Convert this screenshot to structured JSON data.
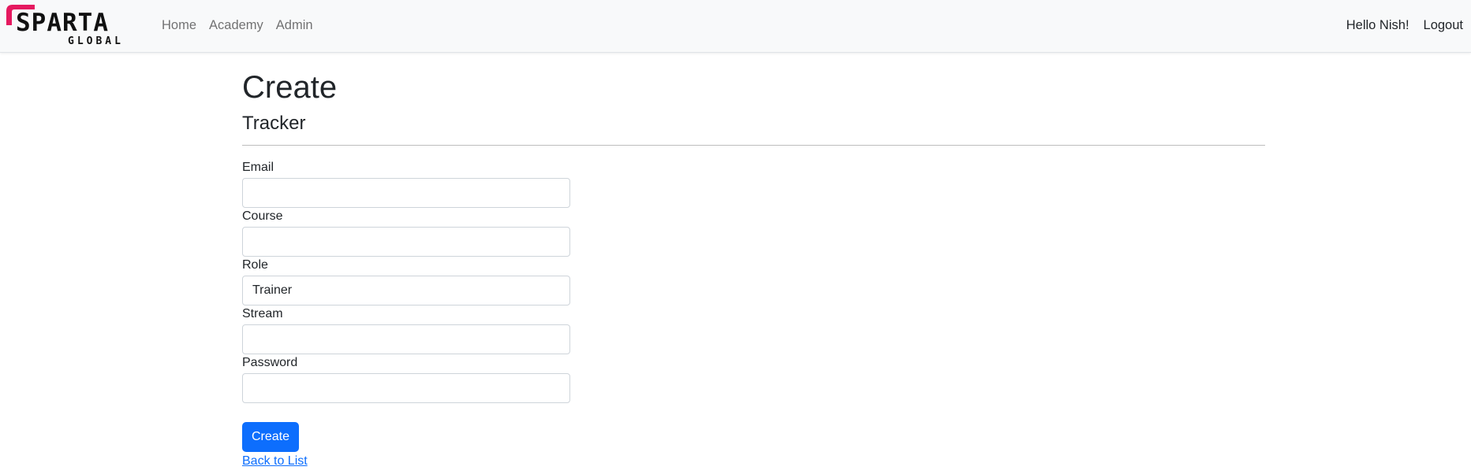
{
  "brand": {
    "name": "SPARTA",
    "sub": "GLOBAL",
    "accent_color": "#e5195f"
  },
  "nav": {
    "links": [
      "Home",
      "Academy",
      "Admin"
    ],
    "greeting": "Hello Nish!",
    "logout": "Logout"
  },
  "page": {
    "title": "Create",
    "subtitle": "Tracker"
  },
  "form": {
    "fields": [
      {
        "label": "Email",
        "value": ""
      },
      {
        "label": "Course",
        "value": ""
      },
      {
        "label": "Role",
        "value": "Trainer"
      },
      {
        "label": "Stream",
        "value": ""
      },
      {
        "label": "Password",
        "value": ""
      }
    ],
    "submit_label": "Create",
    "back_link": "Back to List"
  },
  "colors": {
    "primary": "#0d6efd",
    "navbar_bg": "#f8f9fa"
  }
}
